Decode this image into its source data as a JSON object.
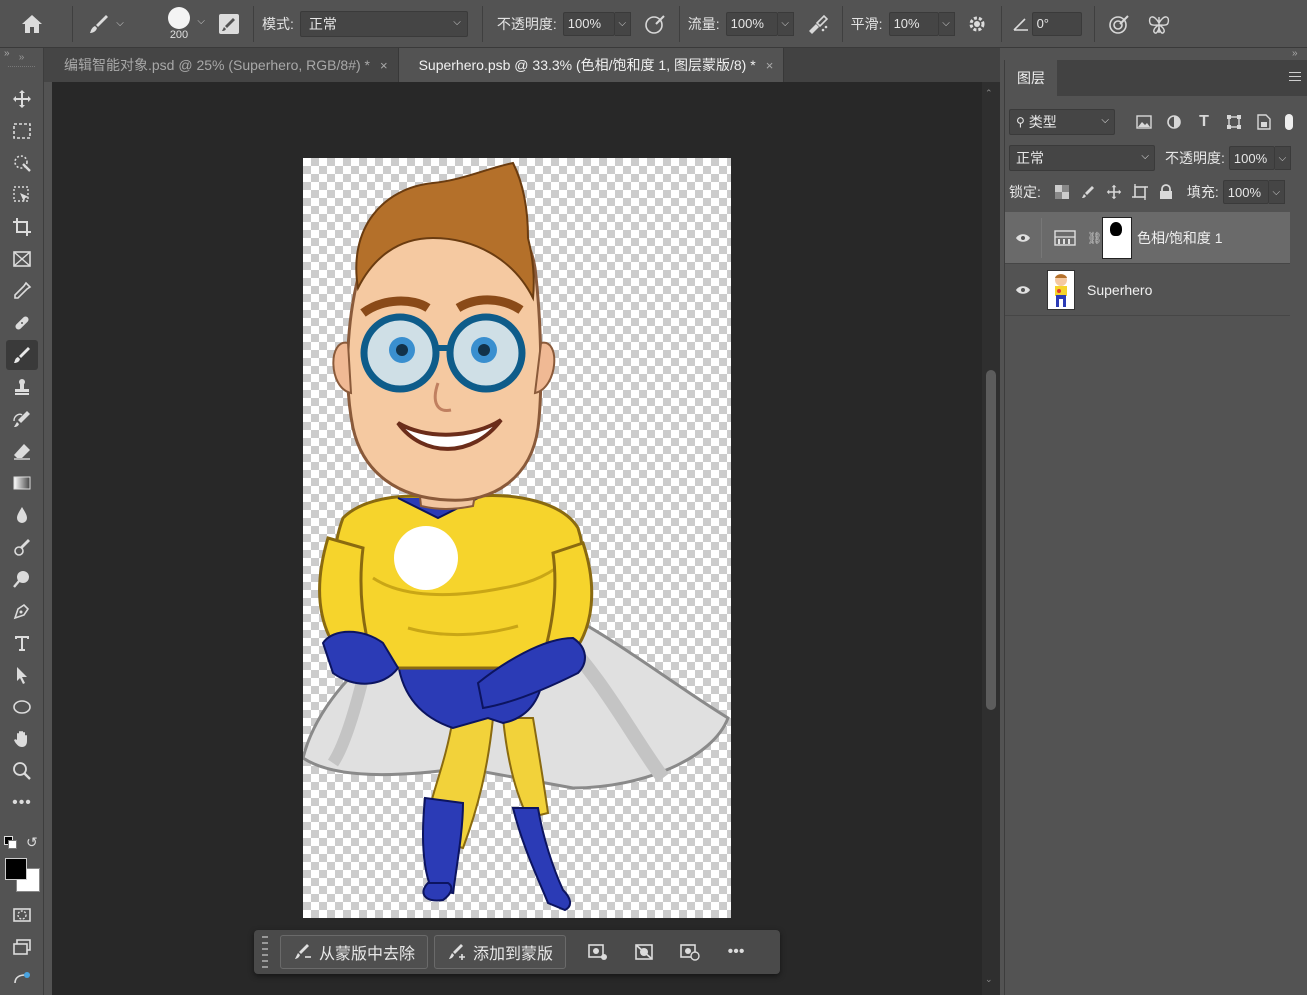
{
  "options_bar": {
    "brush_size": "200",
    "mode_label": "模式:",
    "mode_value": "正常",
    "opacity_label": "不透明度:",
    "opacity_value": "100%",
    "flow_label": "流量:",
    "flow_value": "100%",
    "smoothing_label": "平滑:",
    "smoothing_value": "10%",
    "angle_value": "0°"
  },
  "tabs": [
    {
      "label": "编辑智能对象.psd @ 25% (Superhero, RGB/8#) *",
      "close": "×"
    },
    {
      "label": "Superhero.psb @ 33.3% (色相/饱和度 1, 图层蒙版/8) *",
      "close": "×"
    }
  ],
  "context_bar": {
    "subtract_label": "从蒙版中去除",
    "add_label": "添加到蒙版",
    "more": "•••"
  },
  "layers_panel": {
    "title": "图层",
    "filter_kind": "类型",
    "blend_mode": "正常",
    "opacity_label": "不透明度:",
    "opacity_value": "100%",
    "lock_label": "锁定:",
    "fill_label": "填充:",
    "fill_value": "100%",
    "layers": [
      {
        "name": "色相/饱和度 1",
        "type": "adjustment",
        "selected": true
      },
      {
        "name": "Superhero",
        "type": "pixel",
        "selected": false
      }
    ]
  },
  "colors": {
    "ui_bg": "#535353",
    "canvas_bg": "#282828",
    "selected_layer": "#6a6a6a"
  }
}
